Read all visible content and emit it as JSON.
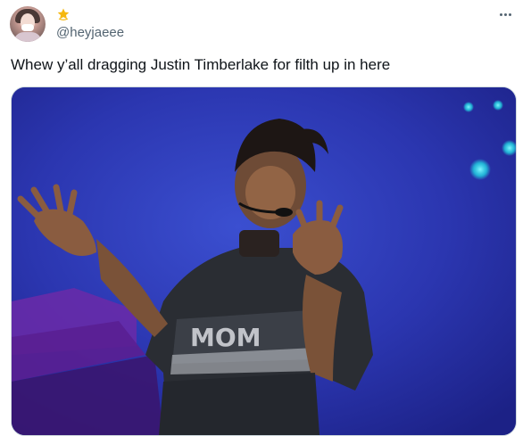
{
  "tweet": {
    "handle": "@heyjaeee",
    "text": "Whew y’all dragging Justin Timberlake for filth up in here",
    "badge_icon": "star-badge-icon",
    "menu_icon": "more-dots-icon"
  },
  "media": {
    "type": "video",
    "description_icon": "concert-performer-image",
    "printed_text": "MOM"
  },
  "colors": {
    "text_primary": "#0f1419",
    "text_secondary": "#536471",
    "border": "#cfd9de",
    "badge": "#f5b70f",
    "stage_blue": "#2a3aa8",
    "stage_light": "#21d4e3"
  }
}
